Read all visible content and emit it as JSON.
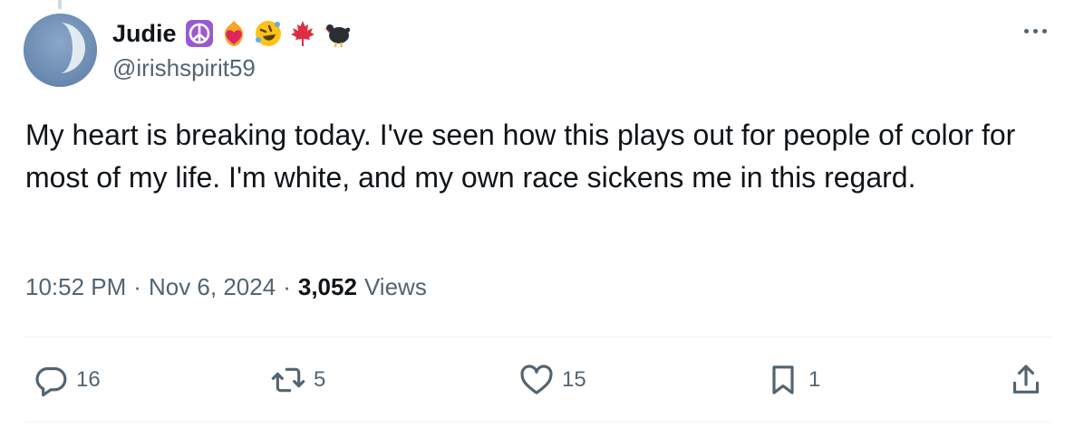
{
  "author": {
    "display_name": "Judie",
    "handle": "@irishspirit59",
    "name_emojis": [
      "peace-symbol-icon",
      "heart-on-fire-icon",
      "rolling-laughing-face-icon",
      "maple-leaf-icon",
      "turkey-icon"
    ]
  },
  "tweet": {
    "text": "My heart is breaking today. I've seen how this plays out for people of color for most of my life. I'm white, and my own race sickens me in this regard."
  },
  "meta": {
    "time": "10:52 PM",
    "date": "Nov 6, 2024",
    "separator": "·",
    "views_count": "3,052",
    "views_label": "Views"
  },
  "actions": {
    "replies": "16",
    "retweets": "5",
    "likes": "15",
    "bookmarks": "1"
  },
  "colors": {
    "text_primary": "#0f1419",
    "text_secondary": "#536471",
    "divider": "#eff3f4"
  }
}
